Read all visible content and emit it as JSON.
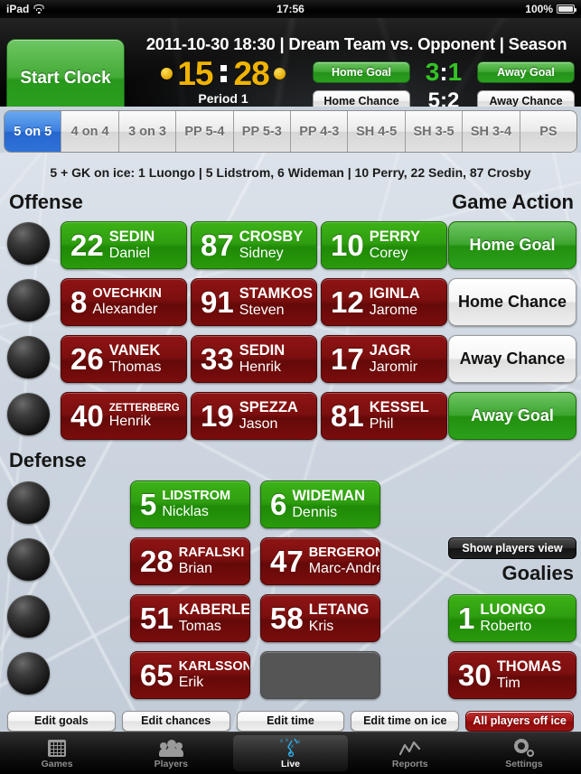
{
  "status_bar": {
    "device": "iPad",
    "wifi_icon": "wifi-icon",
    "time": "17:56",
    "battery_pct": "100%",
    "battery_icon": "battery-full-icon"
  },
  "header": {
    "start_clock_label": "Start Clock",
    "game_title": "2011-10-30 18:30 | Dream Team vs. Opponent | Season",
    "clock": {
      "minutes": "15",
      "seconds": "28",
      "period": "Period 1"
    },
    "home_goal_label": "Home Goal",
    "away_goal_label": "Away Goal",
    "home_chance_label": "Home Chance",
    "away_chance_label": "Away Chance",
    "goals_home": "3",
    "goals_away": "1",
    "chances_home": "5",
    "chances_away": "2",
    "separator": ":",
    "colors": {
      "clock": "#f0b400",
      "goal_green": "#34c424",
      "accent_green": "#2ba01e"
    }
  },
  "strength_tabs": [
    {
      "label": "5 on 5",
      "active": true
    },
    {
      "label": "4 on 4",
      "active": false
    },
    {
      "label": "3 on 3",
      "active": false
    },
    {
      "label": "PP 5-4",
      "active": false
    },
    {
      "label": "PP 5-3",
      "active": false
    },
    {
      "label": "PP 4-3",
      "active": false
    },
    {
      "label": "SH 4-5",
      "active": false
    },
    {
      "label": "SH 3-5",
      "active": false
    },
    {
      "label": "SH 3-4",
      "active": false
    },
    {
      "label": "PS",
      "active": false
    }
  ],
  "on_ice_line": "5 + GK on ice: 1 Luongo | 5 Lidstrom, 6 Wideman | 10 Perry, 22 Sedin, 87 Crosby",
  "offense": {
    "title": "Offense",
    "rows": [
      [
        {
          "number": "22",
          "last": "SEDIN",
          "first": "Daniel",
          "state": "on"
        },
        {
          "number": "87",
          "last": "CROSBY",
          "first": "Sidney",
          "state": "on"
        },
        {
          "number": "10",
          "last": "PERRY",
          "first": "Corey",
          "state": "on"
        }
      ],
      [
        {
          "number": "8",
          "last": "OVECHKIN",
          "first": "Alexander",
          "state": "off"
        },
        {
          "number": "91",
          "last": "STAMKOS",
          "first": "Steven",
          "state": "off"
        },
        {
          "number": "12",
          "last": "IGINLA",
          "first": "Jarome",
          "state": "off"
        }
      ],
      [
        {
          "number": "26",
          "last": "VANEK",
          "first": "Thomas",
          "state": "off"
        },
        {
          "number": "33",
          "last": "SEDIN",
          "first": "Henrik",
          "state": "off"
        },
        {
          "number": "17",
          "last": "JAGR",
          "first": "Jaromir",
          "state": "off"
        }
      ],
      [
        {
          "number": "40",
          "last": "ZETTERBERG",
          "first": "Henrik",
          "state": "off"
        },
        {
          "number": "19",
          "last": "SPEZZA",
          "first": "Jason",
          "state": "off"
        },
        {
          "number": "81",
          "last": "KESSEL",
          "first": "Phil",
          "state": "off"
        }
      ]
    ]
  },
  "defense": {
    "title": "Defense",
    "rows": [
      [
        {
          "number": "5",
          "last": "LIDSTROM",
          "first": "Nicklas",
          "state": "on"
        },
        {
          "number": "6",
          "last": "WIDEMAN",
          "first": "Dennis",
          "state": "on"
        }
      ],
      [
        {
          "number": "28",
          "last": "RAFALSKI",
          "first": "Brian",
          "state": "off"
        },
        {
          "number": "47",
          "last": "BERGERON",
          "first": "Marc-Andre",
          "state": "off"
        }
      ],
      [
        {
          "number": "51",
          "last": "KABERLE",
          "first": "Tomas",
          "state": "off"
        },
        {
          "number": "58",
          "last": "LETANG",
          "first": "Kris",
          "state": "off"
        }
      ],
      [
        {
          "number": "65",
          "last": "KARLSSON",
          "first": "Erik",
          "state": "off"
        },
        {
          "number": "",
          "last": "",
          "first": "",
          "state": "empty"
        }
      ]
    ]
  },
  "game_action": {
    "title": "Game Action",
    "buttons": [
      {
        "label": "Home Goal",
        "style": "green"
      },
      {
        "label": "Home Chance",
        "style": "white"
      },
      {
        "label": "Away Chance",
        "style": "white"
      },
      {
        "label": "Away Goal",
        "style": "green"
      }
    ]
  },
  "show_players_view_label": "Show players view",
  "goalies": {
    "title": "Goalies",
    "players": [
      {
        "number": "1",
        "last": "LUONGO",
        "first": "Roberto",
        "state": "on"
      },
      {
        "number": "30",
        "last": "THOMAS",
        "first": "Tim",
        "state": "off"
      }
    ]
  },
  "toolbar": [
    {
      "label": "Edit goals",
      "style": "normal"
    },
    {
      "label": "Edit chances",
      "style": "normal"
    },
    {
      "label": "Edit time",
      "style": "normal"
    },
    {
      "label": "Edit time on ice",
      "style": "normal"
    },
    {
      "label": "All players off ice",
      "style": "danger"
    }
  ],
  "tab_bar": [
    {
      "label": "Games",
      "icon": "calendar-icon",
      "active": false
    },
    {
      "label": "Players",
      "icon": "people-icon",
      "active": false
    },
    {
      "label": "Live",
      "icon": "playbook-icon",
      "active": true
    },
    {
      "label": "Reports",
      "icon": "chart-line-icon",
      "active": false
    },
    {
      "label": "Settings",
      "icon": "gear-icon",
      "active": false
    }
  ]
}
